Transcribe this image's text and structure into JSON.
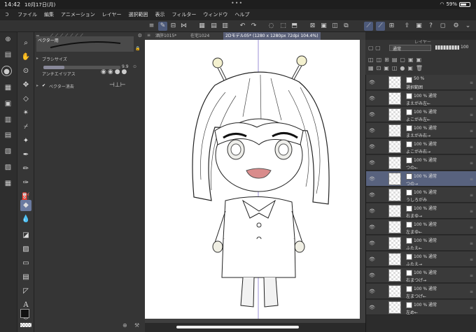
{
  "status": {
    "time": "14:42",
    "date": "10月17日(月)",
    "battery": "59%",
    "dots": "•••",
    "battery_level": 0.59
  },
  "menu": [
    "ファイル",
    "編集",
    "アニメーション",
    "レイヤー",
    "選択範囲",
    "表示",
    "フィルター",
    "ウィンドウ",
    "ヘルプ"
  ],
  "tabs": [
    "酒肝1015*",
    "在宅1024",
    "2Dモデル05* (1280 x 1280px 72dpi 104.4%)"
  ],
  "tool_property": {
    "header": "ベクター用",
    "brush_size_label": "ブラシサイズ",
    "brush_size_value": "9.9",
    "antialias_label": "アンチエイリアス",
    "vector_erase_label": "ベクター消去"
  },
  "layer_panel": {
    "title": "レイヤー",
    "blend_mode": "通常",
    "opacity": "100",
    "layers": [
      {
        "mode": "50 %",
        "name": "選択範囲",
        "selected": false
      },
      {
        "mode": "100 % 通常",
        "name": "まえがみ左←",
        "selected": false
      },
      {
        "mode": "100 % 通常",
        "name": "よこがみ左←",
        "selected": false
      },
      {
        "mode": "100 % 通常",
        "name": "まえがみ右→",
        "selected": false
      },
      {
        "mode": "100 % 通常",
        "name": "よこがみ右→",
        "selected": false
      },
      {
        "mode": "100 % 通常",
        "name": "つの←",
        "selected": false
      },
      {
        "mode": "100 % 通常",
        "name": "つの→",
        "selected": true
      },
      {
        "mode": "100 % 通常",
        "name": "うしろがみ",
        "selected": false
      },
      {
        "mode": "100 % 通常",
        "name": "右まゆ→",
        "selected": false
      },
      {
        "mode": "100 % 通常",
        "name": "左まゆ←",
        "selected": false
      },
      {
        "mode": "100 % 通常",
        "name": "ふたえ←",
        "selected": false
      },
      {
        "mode": "100 % 通常",
        "name": "ふたえ→",
        "selected": false
      },
      {
        "mode": "100 % 通常",
        "name": "右まつげ→",
        "selected": false
      },
      {
        "mode": "100 % 通常",
        "name": "左まつげ←",
        "selected": false
      },
      {
        "mode": "100 % 通常",
        "name": "左め←",
        "selected": false
      }
    ]
  },
  "colors": {
    "accent": "#4d5a7a",
    "selected_layer": "#58627e",
    "lips": "#d98c8c"
  }
}
